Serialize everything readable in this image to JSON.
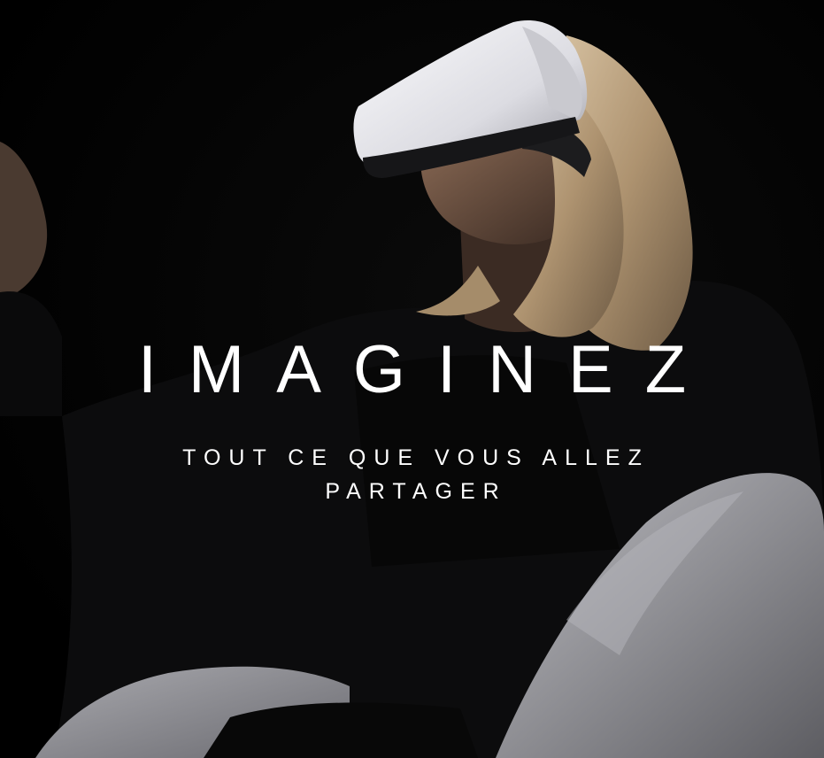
{
  "headline": "IMAGINEZ",
  "tagline": {
    "line1": "TOUT CE QUE VOUS ALLEZ",
    "line2": "PARTAGER"
  },
  "colors": {
    "background": "#000000",
    "text": "#ffffff",
    "headset": "#e9e9ec",
    "chair": "#8f8f94",
    "hair": "#b9a07f",
    "skin": "#6e5140",
    "jacket": "#0c0c0d"
  }
}
